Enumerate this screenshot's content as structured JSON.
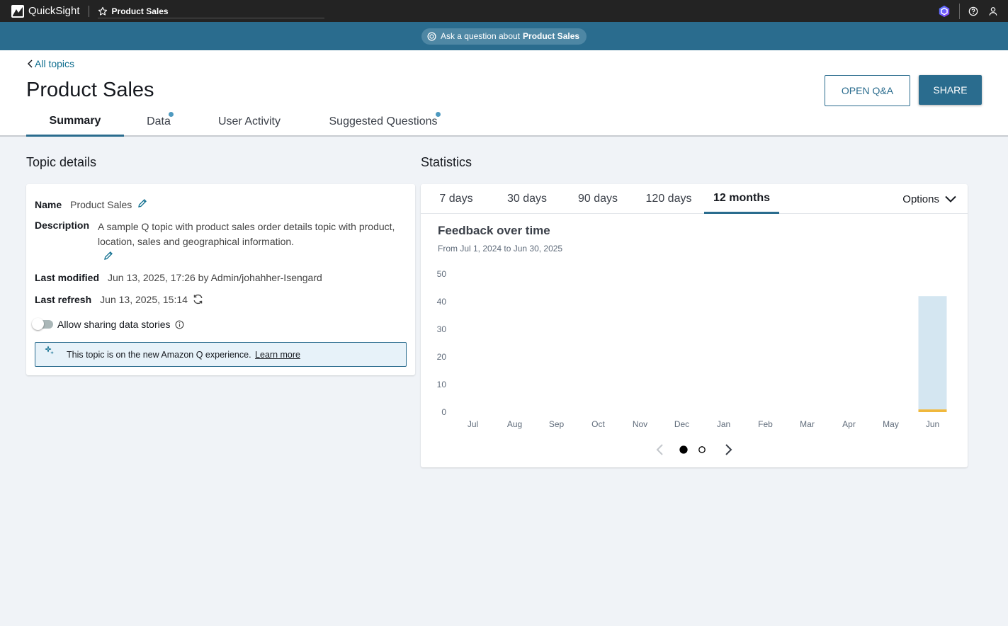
{
  "topnav": {
    "app_name": "QuickSight",
    "current": "Product Sales",
    "icons": [
      "quicksight-logo-icon",
      "star-icon",
      "amazon-q-icon",
      "help-icon",
      "user-icon"
    ]
  },
  "askbar": {
    "prefix": "Ask a question about",
    "topic": "Product Sales"
  },
  "header": {
    "back_label": "All topics",
    "title": "Product Sales",
    "open_qa_label": "OPEN Q&A",
    "share_label": "SHARE",
    "tabs": [
      {
        "label": "Summary",
        "active": true,
        "has_dot": false
      },
      {
        "label": "Data",
        "active": false,
        "has_dot": true
      },
      {
        "label": "User Activity",
        "active": false,
        "has_dot": false
      },
      {
        "label": "Suggested Questions",
        "active": false,
        "has_dot": true
      }
    ]
  },
  "topic_details": {
    "heading": "Topic details",
    "name_label": "Name",
    "name_value": "Product Sales",
    "description_label": "Description",
    "description_value": "A sample Q topic with product sales order details topic with product, location, sales and geographical information.",
    "last_modified_label": "Last modified",
    "last_modified_value": "Jun 13, 2025, 17:26 by Admin/johahher-Isengard",
    "last_refresh_label": "Last refresh",
    "last_refresh_value": "Jun 13, 2025, 15:14",
    "toggle_label": "Allow sharing data stories",
    "toggle_on": false,
    "notice_text": "This topic is on the new Amazon Q experience.",
    "notice_link": "Learn more"
  },
  "statistics": {
    "heading": "Statistics",
    "ranges": [
      {
        "label": "7 days",
        "active": false
      },
      {
        "label": "30 days",
        "active": false
      },
      {
        "label": "90 days",
        "active": false
      },
      {
        "label": "120 days",
        "active": false
      },
      {
        "label": "12 months",
        "active": true
      }
    ],
    "options_label": "Options",
    "page_index": 0,
    "page_count": 2
  },
  "colors": {
    "accent": "#2a6c8e",
    "bar_main": "#d4e6f1",
    "bar_base": "#f0b83c"
  },
  "chart_data": {
    "type": "bar",
    "title": "Feedback over time",
    "subtitle": "From Jul 1, 2024 to Jun 30, 2025",
    "categories": [
      "Jul",
      "Aug",
      "Sep",
      "Oct",
      "Nov",
      "Dec",
      "Jan",
      "Feb",
      "Mar",
      "Apr",
      "May",
      "Jun"
    ],
    "stacked": true,
    "series": [
      {
        "color": "#f0b83c",
        "values": [
          0,
          0,
          0,
          0,
          0,
          0,
          0,
          0,
          0,
          0,
          0,
          1
        ]
      },
      {
        "color": "#d4e6f1",
        "values": [
          0,
          0,
          0,
          0,
          0,
          0,
          0,
          0,
          0,
          0,
          0,
          41
        ]
      }
    ],
    "yticks": [
      0,
      10,
      20,
      30,
      40,
      50
    ],
    "ylim": [
      0,
      50
    ],
    "grid": false,
    "legend": "none"
  }
}
